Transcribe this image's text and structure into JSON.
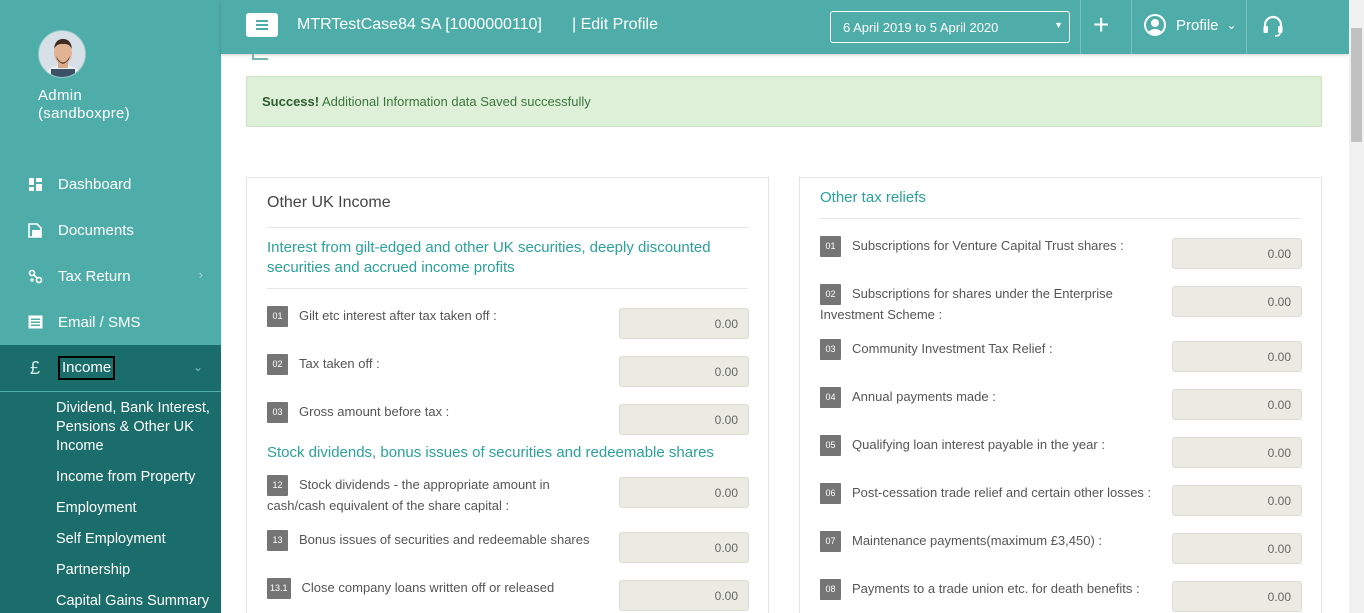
{
  "user": {
    "name_line1": "Admin",
    "name_line2": "(sandboxpre)"
  },
  "nav": {
    "dashboard": "Dashboard",
    "documents": "Documents",
    "tax_return": "Tax Return",
    "email_sms": "Email / SMS",
    "income": "Income",
    "income_symbol": "£"
  },
  "submenu": {
    "dividend": "Dividend, Bank Interest, Pensions & Other UK Income",
    "property": "Income from Property",
    "employment": "Employment",
    "self_employment": "Self Employment",
    "partnership": "Partnership",
    "capital_gains": "Capital Gains Summary"
  },
  "header": {
    "client": "MTRTestCase84 SA [1000000110]",
    "page": "| Edit Profile",
    "period": "6 April 2019 to 5 April 2020",
    "plus": "+",
    "profile": "Profile"
  },
  "alert": {
    "strong": "Success!",
    "message": " Additional Information data Saved successfully"
  },
  "left_panel": {
    "title": "Other UK Income",
    "section1": "Interest from gilt-edged and other UK securities, deeply discounted securities and accrued income profits",
    "section2": "Stock dividends, bonus issues of securities and redeemable shares",
    "rows": [
      {
        "num": "01",
        "label": "Gilt etc interest after tax taken off :",
        "value": "0.00"
      },
      {
        "num": "02",
        "label": "Tax taken off :",
        "value": "0.00"
      },
      {
        "num": "03",
        "label": "Gross amount before tax :",
        "value": "0.00"
      },
      {
        "num": "12",
        "label": "Stock dividends - the appropriate amount in cash/cash equivalent of the share capital :",
        "value": "0.00"
      },
      {
        "num": "13",
        "label": "Bonus issues of securities and redeemable shares",
        "value": "0.00"
      },
      {
        "num": "13.1",
        "label": "Close company loans written off or released",
        "value": "0.00"
      }
    ]
  },
  "right_panel": {
    "title": "Other tax reliefs",
    "rows": [
      {
        "num": "01",
        "label": "Subscriptions for Venture Capital Trust shares :",
        "value": "0.00"
      },
      {
        "num": "02",
        "label": "Subscriptions for shares under the Enterprise Investment Scheme :",
        "value": "0.00"
      },
      {
        "num": "03",
        "label": "Community Investment Tax Relief :",
        "value": "0.00"
      },
      {
        "num": "04",
        "label": "Annual payments made :",
        "value": "0.00"
      },
      {
        "num": "05",
        "label": "Qualifying loan interest payable in the year :",
        "value": "0.00"
      },
      {
        "num": "06",
        "label": "Post-cessation trade relief and certain other losses :",
        "value": "0.00"
      },
      {
        "num": "07",
        "label": "Maintenance payments(maximum £3,450) :",
        "value": "0.00"
      },
      {
        "num": "08",
        "label": "Payments to a trade union etc. for death benefits :",
        "value": "0.00"
      }
    ]
  },
  "colors": {
    "teal": "#4fada9",
    "teal_dark": "#1a6d6a",
    "accent_text": "#2aa19b",
    "success_bg": "#dff0d8"
  },
  "icons": [
    "menu-icon",
    "dashboard-icon",
    "documents-icon",
    "tax-return-icon",
    "email-icon",
    "pound-icon",
    "plus-icon",
    "profile-icon",
    "headset-icon"
  ]
}
